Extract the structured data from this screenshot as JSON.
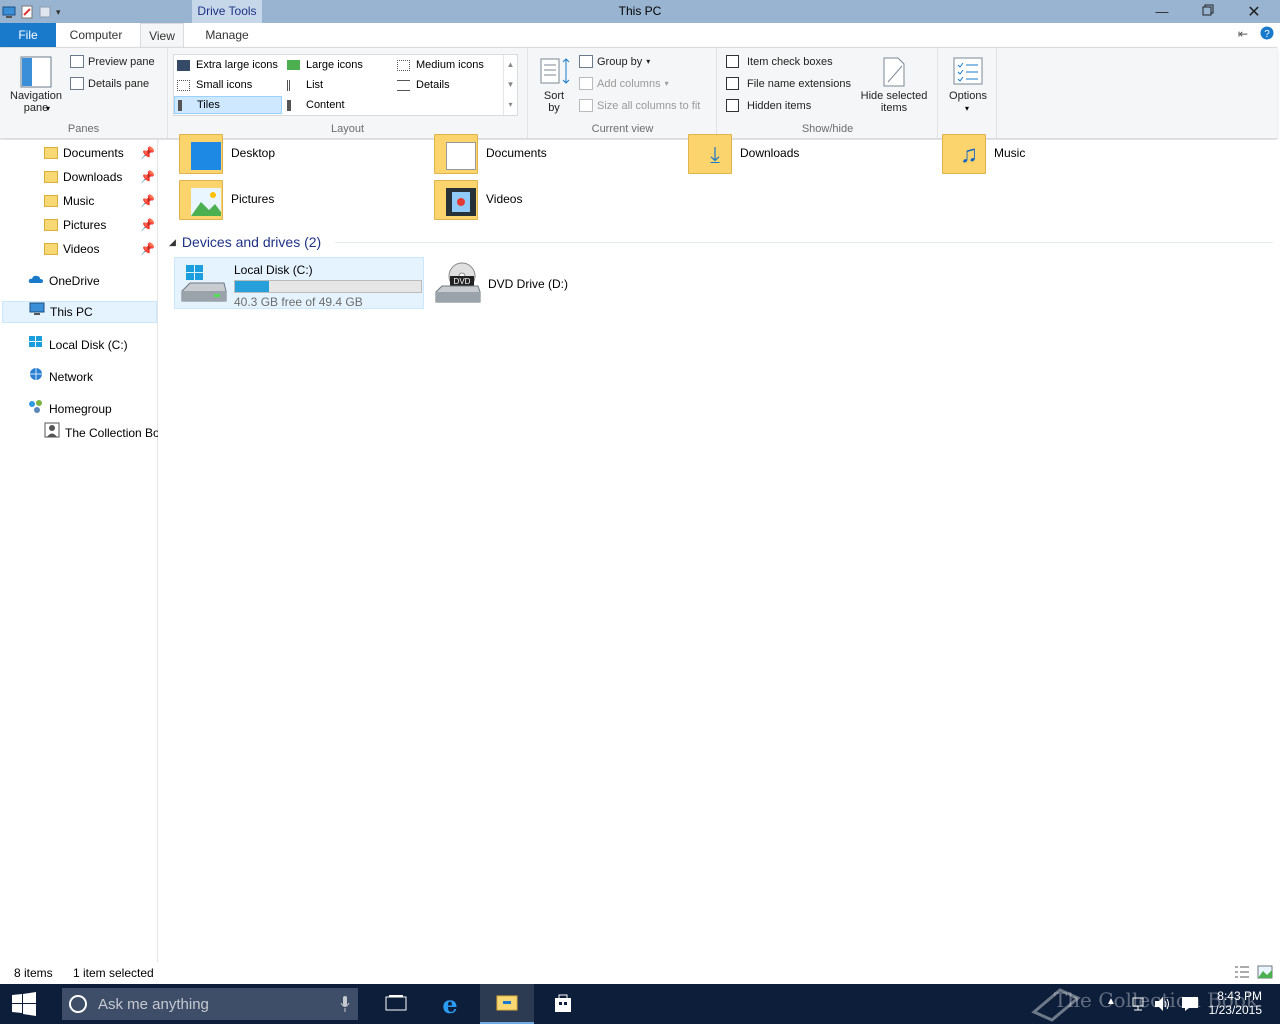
{
  "window": {
    "title": "This PC",
    "context_tab": "Drive Tools",
    "minimize_icon": "minimize-icon",
    "maximize_icon": "restore-icon",
    "close_icon": "close-icon"
  },
  "tabs": {
    "file": "File",
    "computer": "Computer",
    "view": "View",
    "manage": "Manage",
    "active": "View"
  },
  "ribbon": {
    "panes": {
      "label": "Panes",
      "navigation_pane": "Navigation\npane",
      "preview_pane": "Preview pane",
      "details_pane": "Details pane"
    },
    "layout": {
      "label": "Layout",
      "items": [
        "Extra large icons",
        "Large icons",
        "Medium icons",
        "Small icons",
        "List",
        "Details",
        "Tiles",
        "Content"
      ],
      "selected": "Tiles"
    },
    "current_view": {
      "label": "Current view",
      "sort_by": "Sort\nby",
      "group_by": "Group by",
      "add_columns": "Add columns",
      "size_columns": "Size all columns to fit"
    },
    "show_hide": {
      "label": "Show/hide",
      "item_check_boxes": "Item check boxes",
      "file_name_extensions": "File name extensions",
      "hidden_items": "Hidden items",
      "hide_selected": "Hide selected\nitems"
    },
    "options": {
      "label": "Options"
    }
  },
  "nav": {
    "quick_access": [
      {
        "label": "Documents",
        "pinned": true
      },
      {
        "label": "Downloads",
        "pinned": true
      },
      {
        "label": "Music",
        "pinned": true
      },
      {
        "label": "Pictures",
        "pinned": true
      },
      {
        "label": "Videos",
        "pinned": true
      }
    ],
    "onedrive": "OneDrive",
    "this_pc": "This PC",
    "local_disk": "Local Disk (C:)",
    "network": "Network",
    "homegroup": "Homegroup",
    "homegroup_user": "The Collection Bo"
  },
  "content": {
    "folders": [
      {
        "label": "Desktop"
      },
      {
        "label": "Documents"
      },
      {
        "label": "Downloads"
      },
      {
        "label": "Music"
      },
      {
        "label": "Pictures"
      },
      {
        "label": "Videos"
      }
    ],
    "devices_header": "Devices and drives (2)",
    "drives": [
      {
        "label": "Local Disk (C:)",
        "free_text": "40.3 GB free of 49.4 GB",
        "used_fraction": 0.184
      },
      {
        "label": "DVD Drive (D:)"
      }
    ]
  },
  "status": {
    "items": "8 items",
    "selected": "1 item selected"
  },
  "taskbar": {
    "search_placeholder": "Ask me anything",
    "time": "8:43 PM",
    "date": "1/23/2015",
    "watermark": "The Collection Book"
  },
  "colors": {
    "accent": "#1979ca",
    "title_bar": "#99b4d1",
    "taskbar": "#0d1e3a",
    "usage_bar": "#26a0da"
  }
}
